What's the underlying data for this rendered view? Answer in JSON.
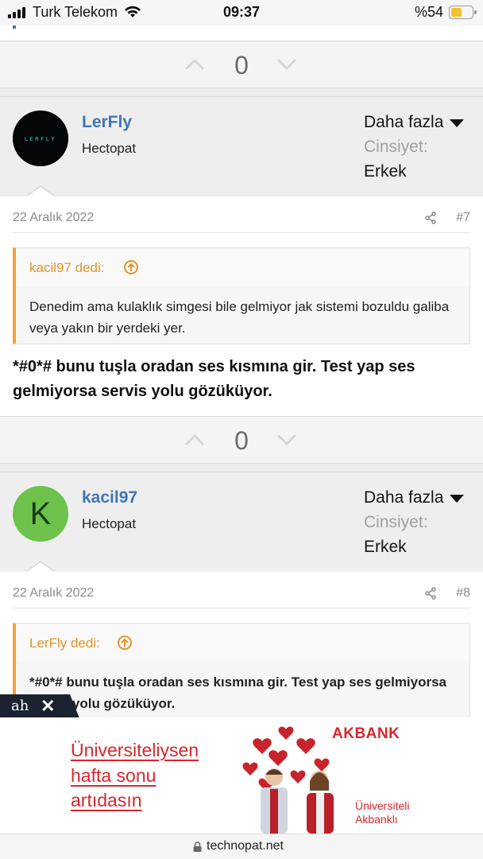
{
  "status_bar": {
    "carrier": "Turk Telekom",
    "time": "09:37",
    "battery_percent": "%54",
    "battery_level": 0.54,
    "battery_color": "#f2c230"
  },
  "posts": [
    {
      "vote_count_above": "0",
      "username": "LerFly",
      "user_title": "Hectopat",
      "more_label": "Daha fazla",
      "gender_label": "Cinsiyet:",
      "gender_value": "Erkek",
      "avatar_text": "LERFLY",
      "date": "22 Aralık 2022",
      "post_number": "#7",
      "quote_author": "kacil97 dedi:",
      "quote_text": "Denedim ama kulaklık simgesi bile gelmiyor jak sistemi bozuldu galiba veya yakın bir yerdeki yer.",
      "reply_text": "*#0*# bunu tuşla oradan ses kısmına gir. Test yap ses gelmiyorsa servis yolu gözüküyor."
    },
    {
      "vote_count_above": "0",
      "username": "kacil97",
      "user_title": "Hectopat",
      "more_label": "Daha fazla",
      "gender_label": "Cinsiyet:",
      "gender_value": "Erkek",
      "avatar_letter": "K",
      "avatar_color": "#6cc24a",
      "date": "22 Aralık 2022",
      "post_number": "#8",
      "quote_author": "LerFly dedi:",
      "quote_text": "*#0*# bunu tuşla oradan ses kısmına gir. Test yap ses gelmiyorsa servis yolu gözüküyor."
    }
  ],
  "ad": {
    "line1": "Üniversiteliysen",
    "line2": "hafta sonu",
    "line3": "artıdasın",
    "brand": "AKBANK",
    "sub1": "Üniversiteli",
    "sub2": "Akbanklı",
    "badge_logo": "ah",
    "close_symbol": "✕"
  },
  "url_bar": {
    "domain": "technopat.net"
  },
  "colors": {
    "username": "#3f76b5",
    "quote_accent": "#efa43c",
    "ad_red": "#d9262e"
  }
}
